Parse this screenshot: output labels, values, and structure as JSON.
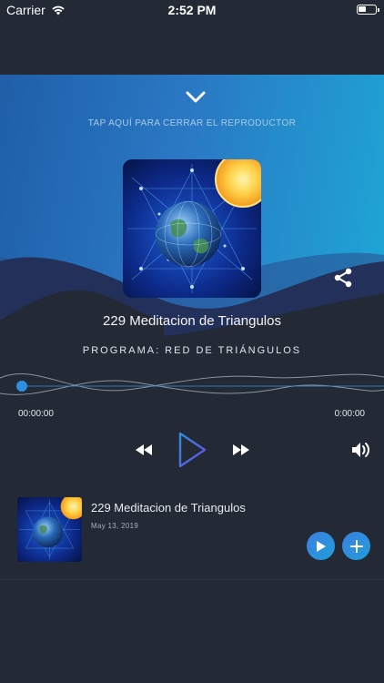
{
  "status_bar": {
    "carrier": "Carrier",
    "time": "2:52 PM"
  },
  "player": {
    "close_hint": "TAP AQUÍ PARA CERRAR EL REPRODUCTOR",
    "title": "229 Meditacion de Triangulos",
    "program": "PROGRAMA: RED DE TRIÁNGULOS",
    "progress": 0,
    "elapsed": "00:00:00",
    "duration": "0:00:00"
  },
  "episode": {
    "title": "229 Meditacion de Triangulos",
    "date": "May 13, 2019"
  },
  "colors": {
    "accent": "#2d8fe0",
    "background": "#232a36",
    "hero_start": "#1f5fa8",
    "hero_end": "#1ea7d6"
  },
  "icons": [
    "wifi-icon",
    "battery-icon",
    "chevron-down-icon",
    "share-icon",
    "rewind-icon",
    "play-icon",
    "fast-forward-icon",
    "volume-icon",
    "plus-icon"
  ]
}
